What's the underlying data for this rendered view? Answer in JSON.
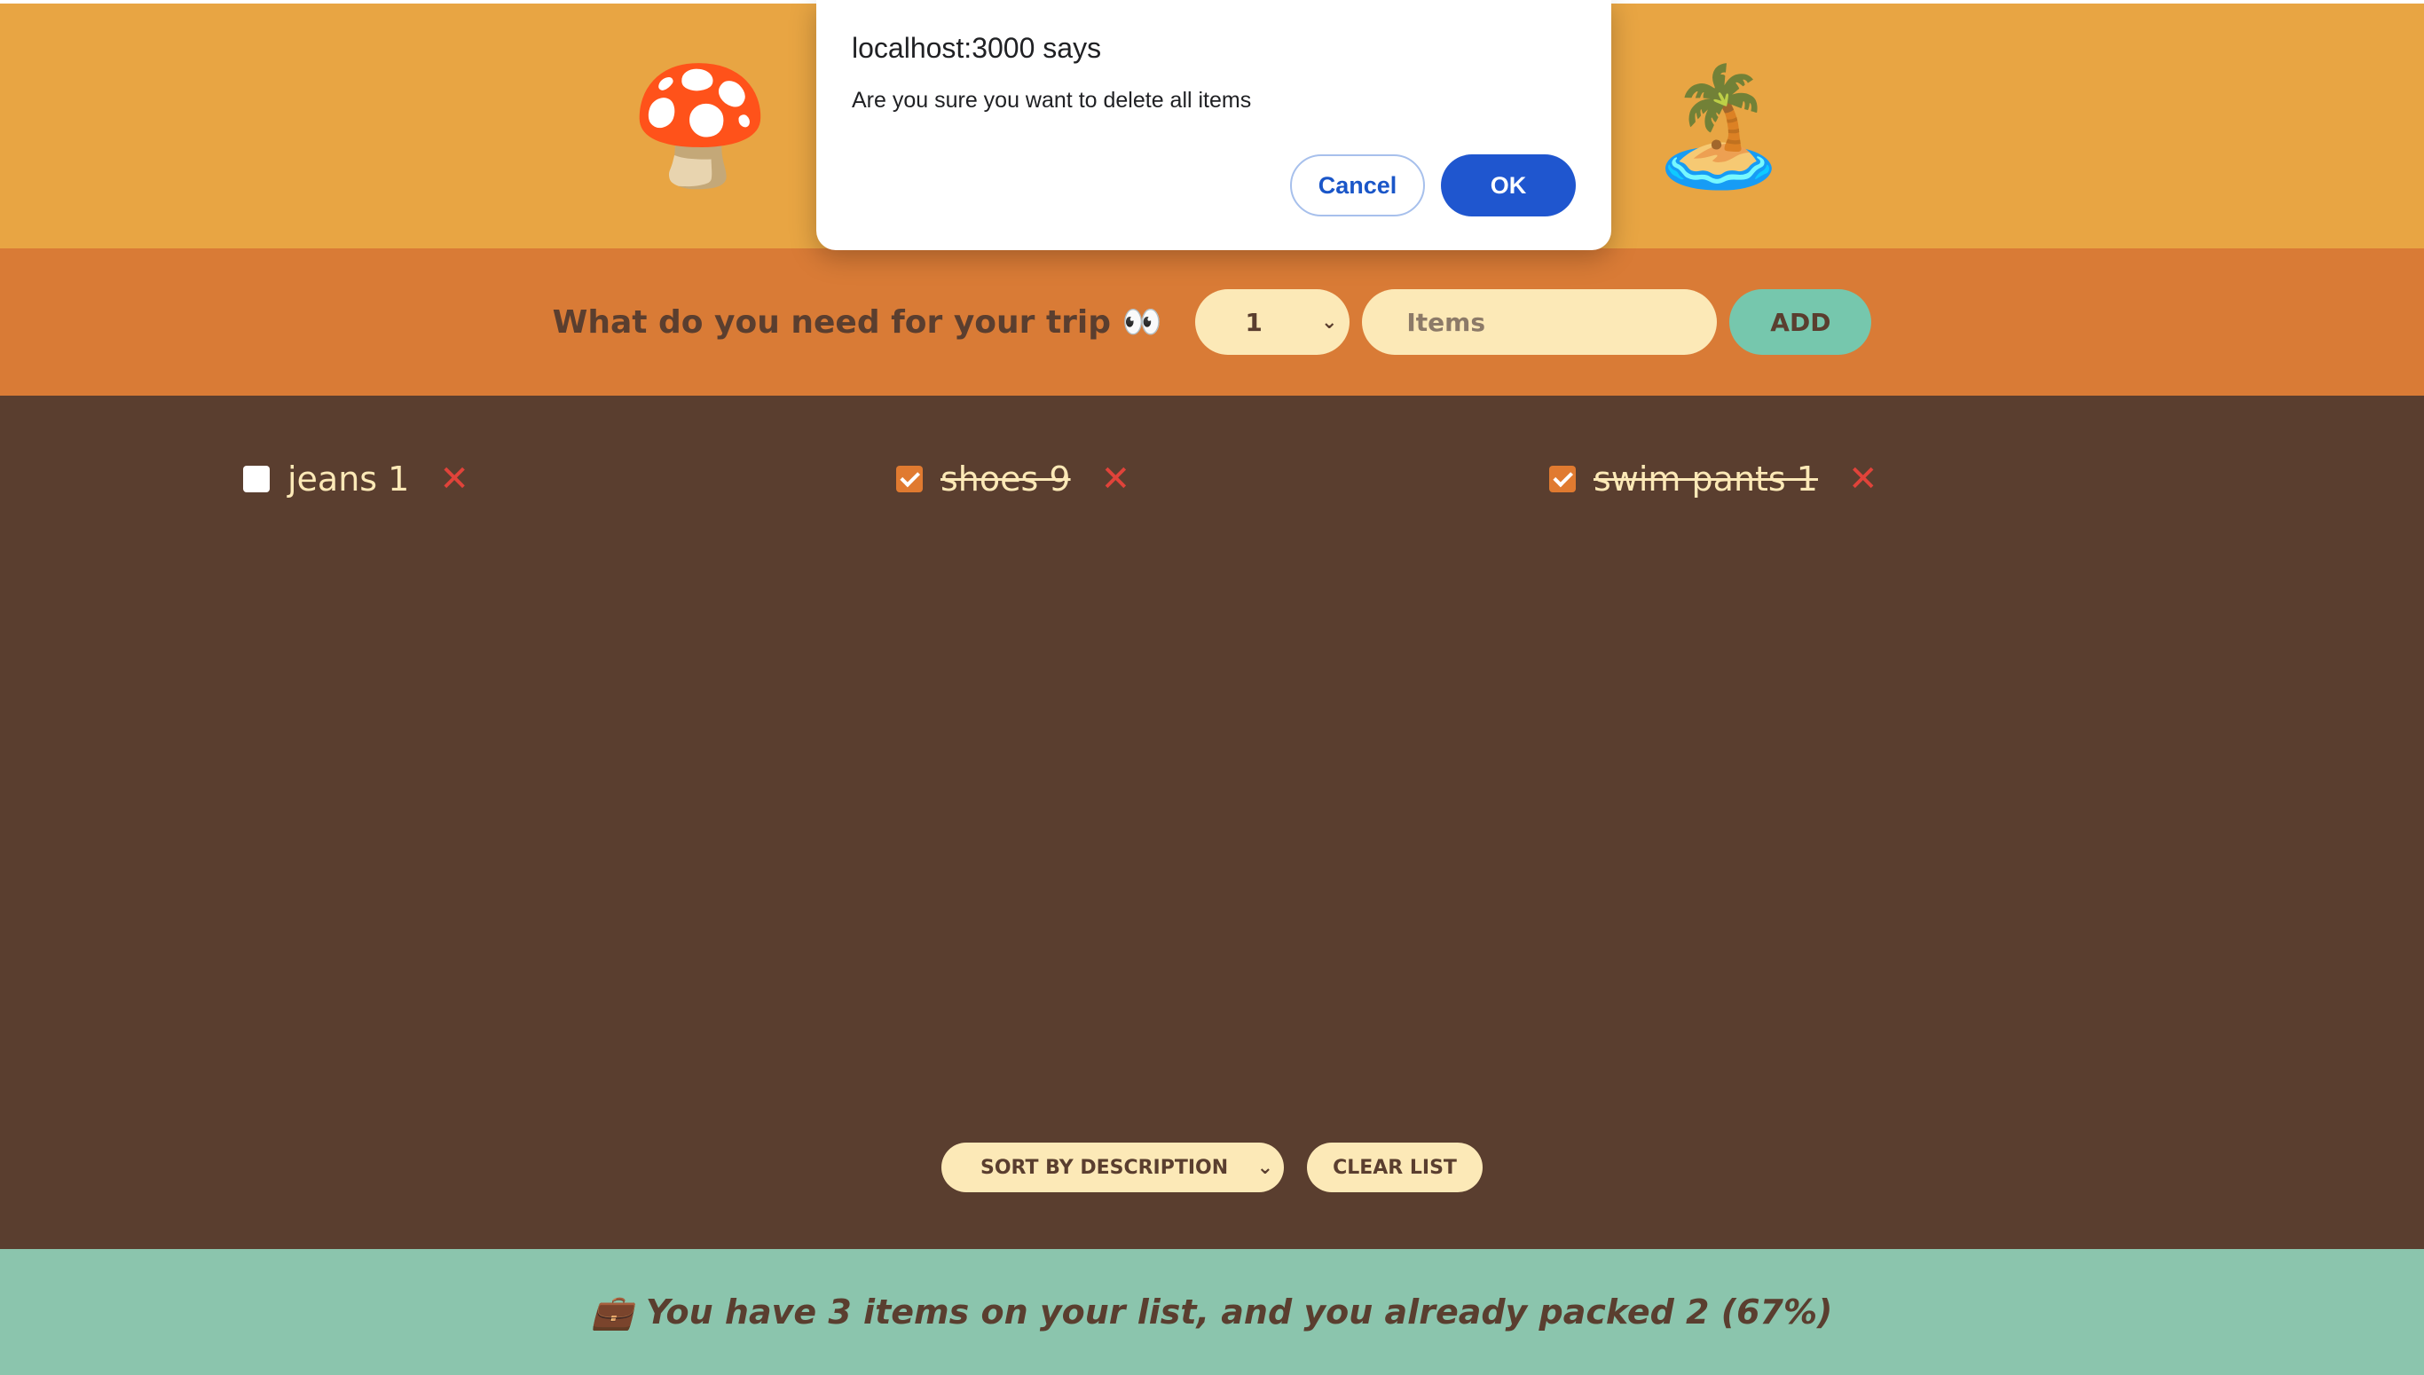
{
  "header": {
    "left_emoji": "🍄",
    "right_emoji": "🏝️"
  },
  "form": {
    "question": "What do you need for your trip 👀",
    "quantity": "1",
    "item_placeholder": "Items",
    "add_label": "ADD"
  },
  "items": [
    {
      "label": "jeans 1",
      "packed": false
    },
    {
      "label": "shoes 9",
      "packed": true
    },
    {
      "label": "swim pants 1",
      "packed": true
    }
  ],
  "delete_symbol": "✕",
  "actions": {
    "sort_label": "SORT BY DESCRIPTION",
    "clear_label": "CLEAR LIST"
  },
  "stats": {
    "icon": "💼",
    "text": "You have 3 items on your list, and you already packed 2 (67%)"
  },
  "dialog": {
    "title": "localhost:3000 says",
    "message": "Are you sure you want to delete all items",
    "cancel_label": "Cancel",
    "ok_label": "OK"
  },
  "colors": {
    "header_bg": "#e8a543",
    "form_bg": "#d97b36",
    "list_bg": "#5a3e2f",
    "stats_bg": "#8bc5ad",
    "delete": "#e0433a",
    "ok_button": "#1f56cf"
  }
}
